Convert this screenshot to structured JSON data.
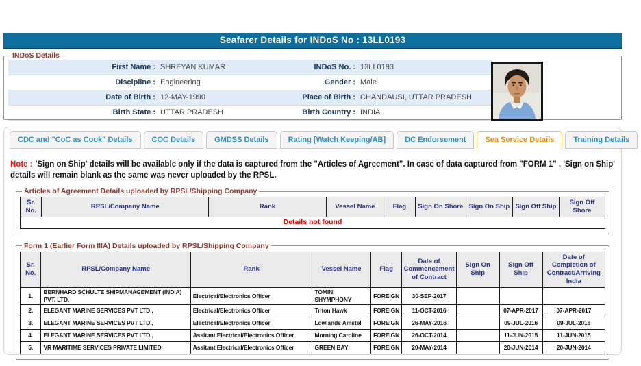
{
  "colors": {
    "title_bar_bg": "#0d6f9e",
    "legend_red": "#9a3324",
    "note_red": "#ff0000",
    "empty_message_red": "#e00000",
    "tab_text": "#2e8fbe",
    "active_tab_text": "#e8930e",
    "active_tab_border": "#f1bf3b",
    "table_header_text": "#24307f",
    "detail_label_navy": "#17365d",
    "alt_row_blue": "#e0ebf8"
  },
  "header": {
    "title": "Seafarer Details for INDoS No : 13LL0193"
  },
  "indos": {
    "legend": "INDoS Details",
    "rows": [
      {
        "l_label": "First Name :",
        "l_value": "SHREYAN KUMAR",
        "r_label": "INDoS No. :",
        "r_value": "13LL0193"
      },
      {
        "l_label": "Discipline :",
        "l_value": "Engineering",
        "r_label": "Gender :",
        "r_value": "Male"
      },
      {
        "l_label": "Date of Birth :",
        "l_value": "12-MAY-1990",
        "r_label": "Place of Birth :",
        "r_value": "CHANDAUSI, UTTAR PRADESH"
      },
      {
        "l_label": "Birth State :",
        "l_value": "UTTAR PRADESH",
        "r_label": "Birth Country :",
        "r_value": "INDIA"
      }
    ]
  },
  "tabs": [
    {
      "label": "CDC and \"CoC as Cook\" Details",
      "active": false
    },
    {
      "label": "COC Details",
      "active": false
    },
    {
      "label": "GMDSS Details",
      "active": false
    },
    {
      "label": "Rating [Watch Keeping/AB]",
      "active": false
    },
    {
      "label": "DC Endorsement",
      "active": false
    },
    {
      "label": "Sea Service Details",
      "active": true
    },
    {
      "label": "Training Details",
      "active": false
    }
  ],
  "note": {
    "prefix": "Note :",
    "text": "'Sign on Ship' details will be available only if the data is captured from the \"Articles of Agreement\". In case of data captured from \"FORM 1\" , 'Sign on Ship' details will remain blank as the same was never uploaded by the RPSL."
  },
  "articles": {
    "legend": "Articles of Agreement Details uploaded by RPSL/Shipping Company",
    "headers": [
      "Sr. No.",
      "RPSL/Company Name",
      "Rank",
      "Vessel Name",
      "Flag",
      "Sign On Shore",
      "Sign On Ship",
      "Sign Off Ship",
      "Sign Off Shore"
    ],
    "empty_message": "Details not found"
  },
  "form1": {
    "legend": "Form 1 (Earlier Form IIIA) Details uploaded by RPSL/Shipping Company",
    "headers": [
      "Sr. No.",
      "RPSL/Company Name",
      "Rank",
      "Vessel Name",
      "Flag",
      "Date of Commencement of Contract",
      "Sign On Ship",
      "Sign Off Ship",
      "Date of Completion of Contract/Arriving India"
    ],
    "rows": [
      [
        "1.",
        "BERNHARD SCHULTE SHIPMANAGEMENT (INDIA) PVT. LTD.",
        "Electrical/Electronics Officer",
        "TOMINI SHYMPHONY",
        "FOREIGN",
        "30-SEP-2017",
        "",
        "",
        ""
      ],
      [
        "2.",
        "ELEGANT MARINE SERVICES PVT LTD.,",
        "Electrical/Electronics Officer",
        "Triton Hawk",
        "FOREIGN",
        "11-OCT-2016",
        "",
        "07-APR-2017",
        "07-APR-2017"
      ],
      [
        "3.",
        "ELEGANT MARINE SERVICES PVT LTD.,",
        "Electrical/Electronics Officer",
        "Lowlands Amstel",
        "FOREIGN",
        "26-MAY-2016",
        "",
        "09-JUL-2016",
        "09-JUL-2016"
      ],
      [
        "4.",
        "ELEGANT MARINE SERVICES PVT LTD.,",
        "Assitant Electrical/Electronics Officer",
        "Morning Caroline",
        "FOREIGN",
        "26-OCT-2014",
        "",
        "11-JUN-2015",
        "11-JUN-2015"
      ],
      [
        "5.",
        "VR MARITIME SERVICES PRIVATE LIMITED",
        "Assitant Electrical/Electronics Officer",
        "GREEN BAY",
        "FOREIGN",
        "20-MAY-2014",
        "",
        "20-JUN-2014",
        "20-JUN-2014"
      ]
    ]
  }
}
